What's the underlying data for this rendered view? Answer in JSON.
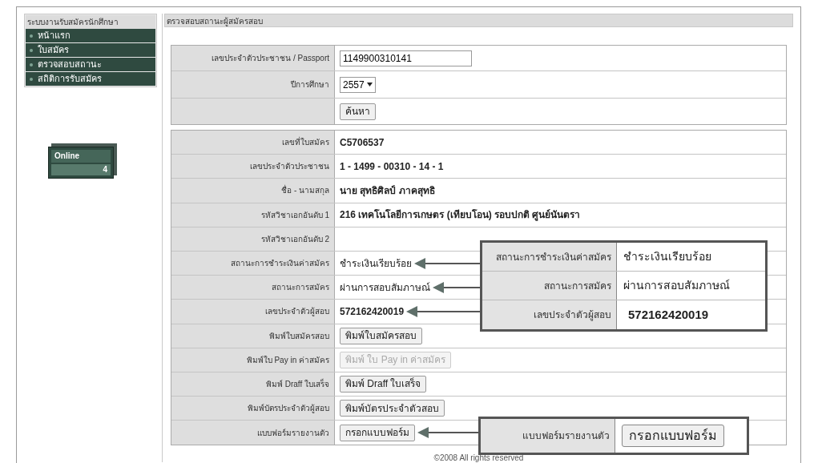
{
  "sidebar": {
    "title": "ระบบงานรับสมัครนักศึกษา",
    "items": [
      {
        "label": "หน้าแรก"
      },
      {
        "label": "ใบสมัคร"
      },
      {
        "label": "ตรวจสอบสถานะ"
      },
      {
        "label": "สถิติการรับสมัคร"
      }
    ]
  },
  "online": {
    "label": "Online",
    "count": "4"
  },
  "main": {
    "title": "ตรวจสอบสถานะผู้สมัครสอบ",
    "search_form": {
      "id_label": "เลขประจำตัวประชาชน / Passport",
      "id_value": "1149900310141",
      "year_label": "ปีการศึกษา",
      "year_value": "2557",
      "search_button": "ค้นหา"
    },
    "details": [
      {
        "label": "เลขที่ใบสมัคร",
        "kind": "strong",
        "value": "C5706537",
        "arrow": false
      },
      {
        "label": "เลขประจำตัวประชาชน",
        "kind": "strong",
        "value": "1 - 1499 - 00310 - 14 - 1",
        "arrow": false
      },
      {
        "label": "ชื่อ - นามสกุล",
        "kind": "strong",
        "value": "นาย สุทธิศิลป์ ภาคสุทธิ",
        "arrow": false
      },
      {
        "label": "รหัสวิชาเอกอันดับ 1",
        "kind": "strong",
        "value": "216 เทคโนโลยีการเกษตร (เทียบโอน) รอบปกติ ศูนย์นันตรา",
        "arrow": false
      },
      {
        "label": "รหัสวิชาเอกอันดับ 2",
        "kind": "strong",
        "arrow": false
      },
      {
        "label": "สถานะการชำระเงินค่าสมัคร",
        "kind": "text",
        "value": "ชำระเงินเรียบร้อย",
        "arrow": true
      },
      {
        "label": "สถานะการสมัคร",
        "kind": "text",
        "value": "ผ่านการสอบสัมภาษณ์",
        "arrow": true
      },
      {
        "label": "เลขประจำตัวผู้สอบ",
        "kind": "strong",
        "value": "572162420019",
        "arrow": true
      },
      {
        "label": "พิมพ์ใบสมัครสอบ",
        "kind": "button",
        "value": "พิมพ์ใบสมัครสอบ",
        "disabled": false,
        "arrow": false
      },
      {
        "label": "พิมพ์ใบ Pay in ค่าสมัคร",
        "kind": "button",
        "value": "พิมพ์ ใบ Pay in ค่าสมัคร",
        "disabled": true,
        "arrow": false
      },
      {
        "label": "พิมพ์ Draff ใบเสร็จ",
        "kind": "button",
        "value": "พิมพ์ Draff ใบเสร็จ",
        "disabled": false,
        "arrow": false
      },
      {
        "label": "พิมพ์บัตรประจำตัวผู้สอบ",
        "kind": "button",
        "value": "พิมพ์บัตรประจำตัวสอบ",
        "disabled": false,
        "arrow": false
      },
      {
        "label": "แบบฟอร์มรายงานตัว",
        "kind": "button",
        "value": "กรอกแบบฟอร์ม",
        "disabled": false,
        "arrow": true
      }
    ]
  },
  "callouts": [
    {
      "rows": [
        {
          "label": "สถานะการชำระเงินค่าสมัคร",
          "kind": "text",
          "value": "ชำระเงินเรียบร้อย"
        },
        {
          "label": "สถานะการสมัคร",
          "kind": "text",
          "value": "ผ่านการสอบสัมภาษณ์"
        },
        {
          "label": "เลขประจำตัวผู้สอบ",
          "kind": "strong",
          "value": "572162420019"
        }
      ]
    },
    {
      "rows": [
        {
          "label": "แบบฟอร์มรายงานตัว",
          "kind": "button",
          "value": "กรอกแบบฟอร์ม"
        }
      ]
    }
  ],
  "footer": "©2008 All rights reserved"
}
